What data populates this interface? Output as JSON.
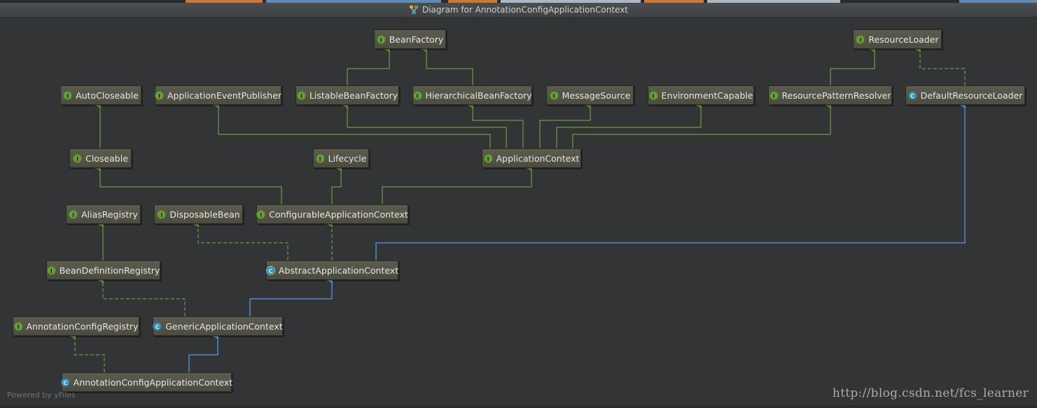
{
  "window": {
    "title": "Diagram for AnnotationConfigApplicationContext"
  },
  "colors": {
    "background": "#323436",
    "node_fill": "#56564a",
    "extends_edge": "#6a9e3c",
    "class_extends_edge": "#5a9bea",
    "interface_badge": "#6a9e3c",
    "class_badge": "#3e8fb0"
  },
  "nodes": [
    {
      "id": "BeanFactory",
      "label": "BeanFactory",
      "kind": "interface"
    },
    {
      "id": "ResourceLoader",
      "label": "ResourceLoader",
      "kind": "interface"
    },
    {
      "id": "AutoCloseable",
      "label": "AutoCloseable",
      "kind": "interface"
    },
    {
      "id": "ApplicationEventPublisher",
      "label": "ApplicationEventPublisher",
      "kind": "interface"
    },
    {
      "id": "ListableBeanFactory",
      "label": "ListableBeanFactory",
      "kind": "interface"
    },
    {
      "id": "HierarchicalBeanFactory",
      "label": "HierarchicalBeanFactory",
      "kind": "interface"
    },
    {
      "id": "MessageSource",
      "label": "MessageSource",
      "kind": "interface"
    },
    {
      "id": "EnvironmentCapable",
      "label": "EnvironmentCapable",
      "kind": "interface"
    },
    {
      "id": "ResourcePatternResolver",
      "label": "ResourcePatternResolver",
      "kind": "interface"
    },
    {
      "id": "DefaultResourceLoader",
      "label": "DefaultResourceLoader",
      "kind": "class"
    },
    {
      "id": "Closeable",
      "label": "Closeable",
      "kind": "interface"
    },
    {
      "id": "Lifecycle",
      "label": "Lifecycle",
      "kind": "interface"
    },
    {
      "id": "ApplicationContext",
      "label": "ApplicationContext",
      "kind": "interface"
    },
    {
      "id": "AliasRegistry",
      "label": "AliasRegistry",
      "kind": "interface"
    },
    {
      "id": "DisposableBean",
      "label": "DisposableBean",
      "kind": "interface"
    },
    {
      "id": "ConfigurableApplicationContext",
      "label": "ConfigurableApplicationContext",
      "kind": "interface"
    },
    {
      "id": "BeanDefinitionRegistry",
      "label": "BeanDefinitionRegistry",
      "kind": "interface"
    },
    {
      "id": "AbstractApplicationContext",
      "label": "AbstractApplicationContext",
      "kind": "abstract"
    },
    {
      "id": "AnnotationConfigRegistry",
      "label": "AnnotationConfigRegistry",
      "kind": "interface"
    },
    {
      "id": "GenericApplicationContext",
      "label": "GenericApplicationContext",
      "kind": "class"
    },
    {
      "id": "AnnotationConfigApplicationContext",
      "label": "AnnotationConfigApplicationContext",
      "kind": "class"
    }
  ],
  "edges": [
    {
      "from": "ListableBeanFactory",
      "to": "BeanFactory",
      "type": "extends"
    },
    {
      "from": "HierarchicalBeanFactory",
      "to": "BeanFactory",
      "type": "extends"
    },
    {
      "from": "ResourcePatternResolver",
      "to": "ResourceLoader",
      "type": "extends"
    },
    {
      "from": "DefaultResourceLoader",
      "to": "ResourceLoader",
      "type": "implements"
    },
    {
      "from": "Closeable",
      "to": "AutoCloseable",
      "type": "extends"
    },
    {
      "from": "ApplicationContext",
      "to": "ApplicationEventPublisher",
      "type": "extends"
    },
    {
      "from": "ApplicationContext",
      "to": "ListableBeanFactory",
      "type": "extends"
    },
    {
      "from": "ApplicationContext",
      "to": "HierarchicalBeanFactory",
      "type": "extends"
    },
    {
      "from": "ApplicationContext",
      "to": "MessageSource",
      "type": "extends"
    },
    {
      "from": "ApplicationContext",
      "to": "EnvironmentCapable",
      "type": "extends"
    },
    {
      "from": "ApplicationContext",
      "to": "ResourcePatternResolver",
      "type": "extends"
    },
    {
      "from": "ConfigurableApplicationContext",
      "to": "Closeable",
      "type": "extends"
    },
    {
      "from": "ConfigurableApplicationContext",
      "to": "Lifecycle",
      "type": "extends"
    },
    {
      "from": "ConfigurableApplicationContext",
      "to": "ApplicationContext",
      "type": "extends"
    },
    {
      "from": "BeanDefinitionRegistry",
      "to": "AliasRegistry",
      "type": "extends"
    },
    {
      "from": "AbstractApplicationContext",
      "to": "DisposableBean",
      "type": "implements"
    },
    {
      "from": "AbstractApplicationContext",
      "to": "ConfigurableApplicationContext",
      "type": "implements"
    },
    {
      "from": "AbstractApplicationContext",
      "to": "DefaultResourceLoader",
      "type": "class-extends"
    },
    {
      "from": "GenericApplicationContext",
      "to": "BeanDefinitionRegistry",
      "type": "implements"
    },
    {
      "from": "GenericApplicationContext",
      "to": "AbstractApplicationContext",
      "type": "class-extends"
    },
    {
      "from": "AnnotationConfigApplicationContext",
      "to": "AnnotationConfigRegistry",
      "type": "implements"
    },
    {
      "from": "AnnotationConfigApplicationContext",
      "to": "GenericApplicationContext",
      "type": "class-extends"
    }
  ],
  "footer": {
    "powered_by": "Powered by yFiles",
    "watermark": "http://blog.csdn.net/fcs_learner"
  }
}
